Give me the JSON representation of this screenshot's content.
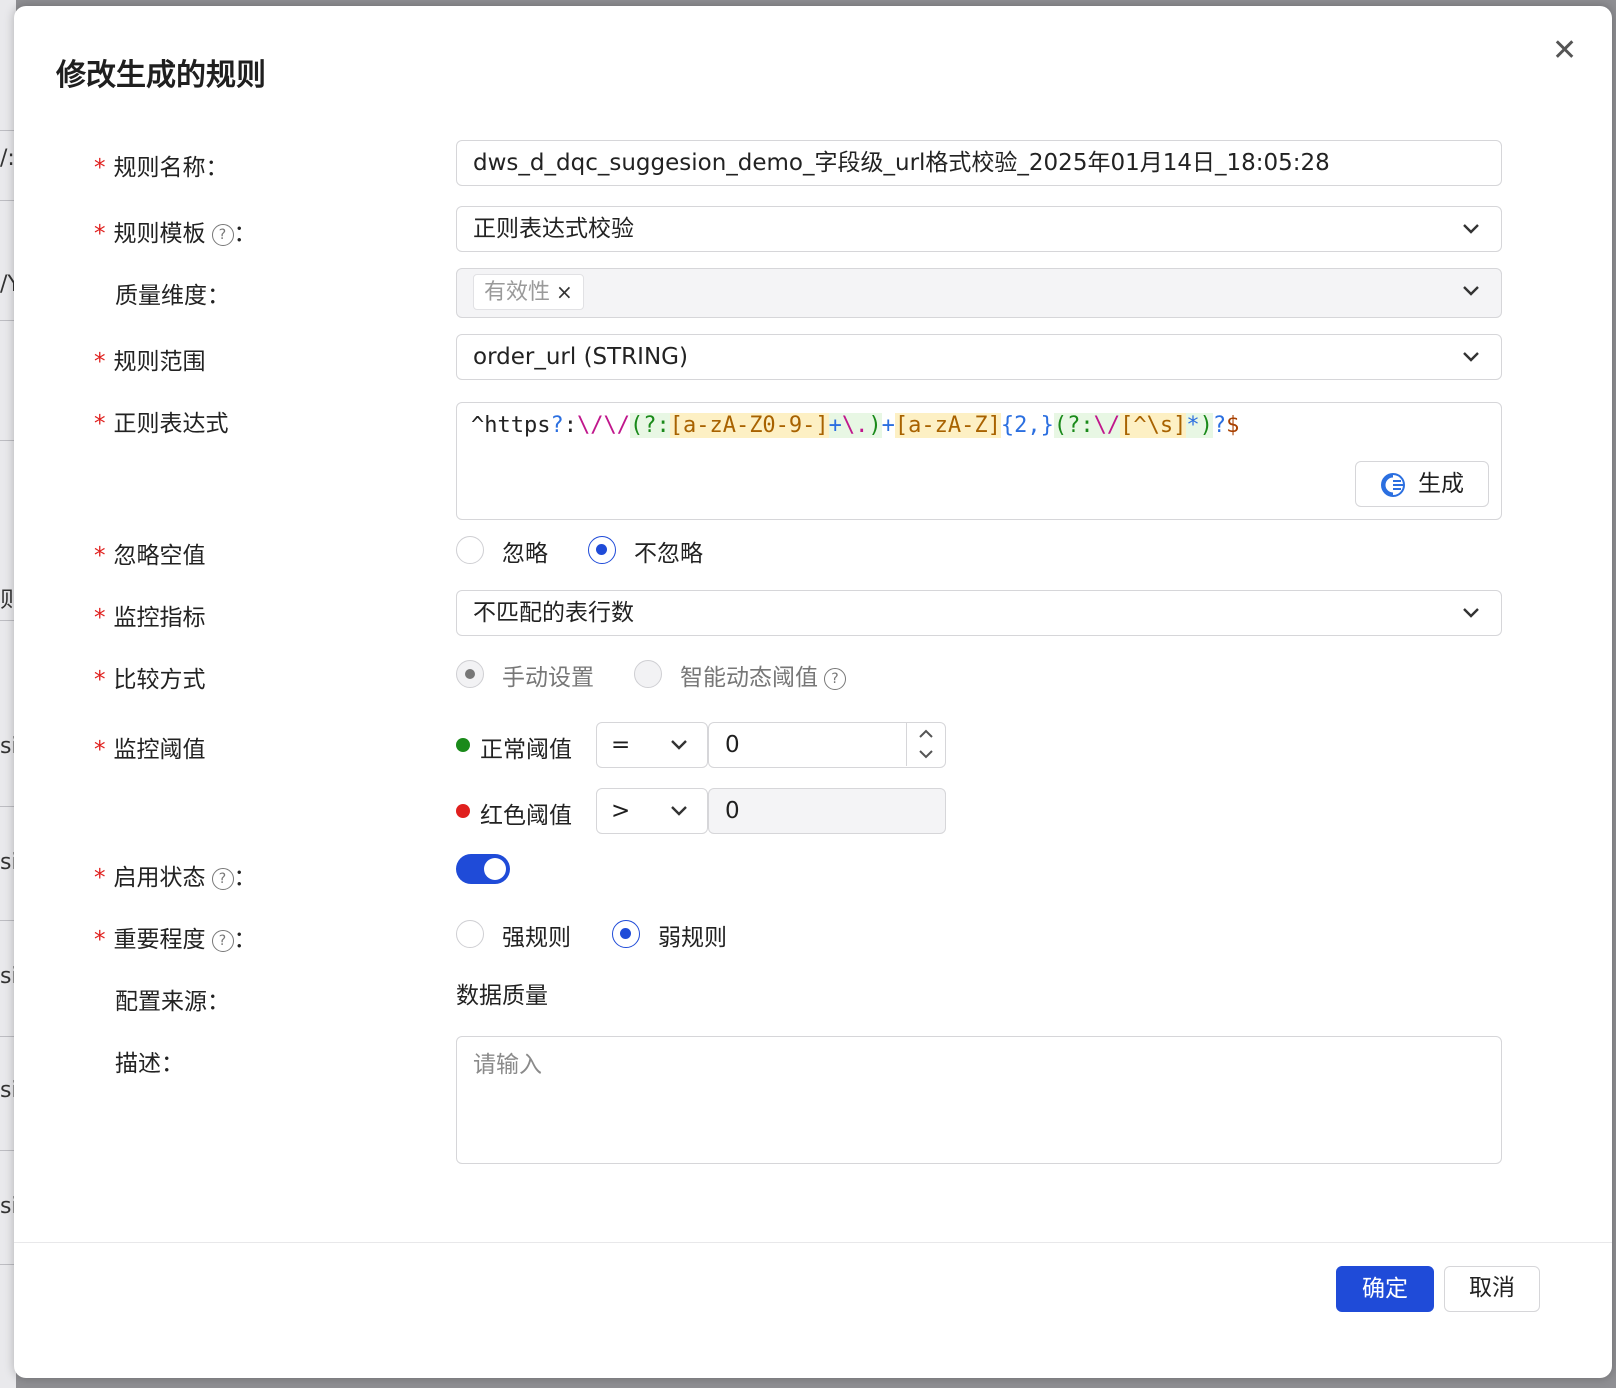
{
  "background_fragments": [
    "/:",
    "/Y",
    "则",
    "si",
    "si",
    "si",
    "si",
    "si"
  ],
  "dialog": {
    "title": "修改生成的规则",
    "close_icon": "close-icon",
    "colors": {
      "primary": "#1f4bd8",
      "required": "#e0201e",
      "normal_dot": "#1a8a1a",
      "red_dot": "#e0201e"
    }
  },
  "form": {
    "rule_name": {
      "label": "规则名称",
      "suffix": "：",
      "value": "dws_d_dqc_suggesion_demo_字段级_url格式校验_2025年01月14日_18:05:28"
    },
    "rule_template": {
      "label": "规则模板",
      "suffix": "：",
      "value": "正则表达式校验"
    },
    "quality_dimension": {
      "label": "质量维度",
      "suffix": "：",
      "tag": "有效性",
      "tag_remove": "×"
    },
    "rule_scope": {
      "label": "规则范围",
      "value": "order_url (STRING)"
    },
    "regex": {
      "label": "正则表达式",
      "tokens": [
        "^https",
        "?",
        ":",
        "\\/\\/",
        "(?:",
        "[a-zA-Z0-9-]",
        "+",
        "\\.",
        ")",
        "+",
        "[a-zA-Z]",
        "{2,}",
        "(?:",
        "\\/",
        "[^\\s]",
        "*",
        ")",
        "?",
        "$"
      ],
      "generate_button": "生成"
    },
    "ignore_null": {
      "label": "忽略空值",
      "options": [
        "忽略",
        "不忽略"
      ],
      "selected": "不忽略"
    },
    "monitor_metric": {
      "label": "监控指标",
      "value": "不匹配的表行数"
    },
    "compare_method": {
      "label": "比较方式",
      "options": [
        "手动设置",
        "智能动态阈值"
      ],
      "selected": "手动设置"
    },
    "threshold": {
      "label": "监控阈值",
      "normal": {
        "label": "正常阈值",
        "operator": "=",
        "value": "0"
      },
      "red": {
        "label": "红色阈值",
        "operator": ">",
        "value": "0"
      }
    },
    "enabled": {
      "label": "启用状态",
      "suffix": "：",
      "value": true
    },
    "importance": {
      "label": "重要程度",
      "suffix": "：",
      "options": [
        "强规则",
        "弱规则"
      ],
      "selected": "弱规则"
    },
    "source": {
      "label": "配置来源",
      "suffix": "：",
      "value": "数据质量"
    },
    "description": {
      "label": "描述",
      "suffix": "：",
      "placeholder": "请输入"
    }
  },
  "footer": {
    "confirm": "确定",
    "cancel": "取消"
  }
}
